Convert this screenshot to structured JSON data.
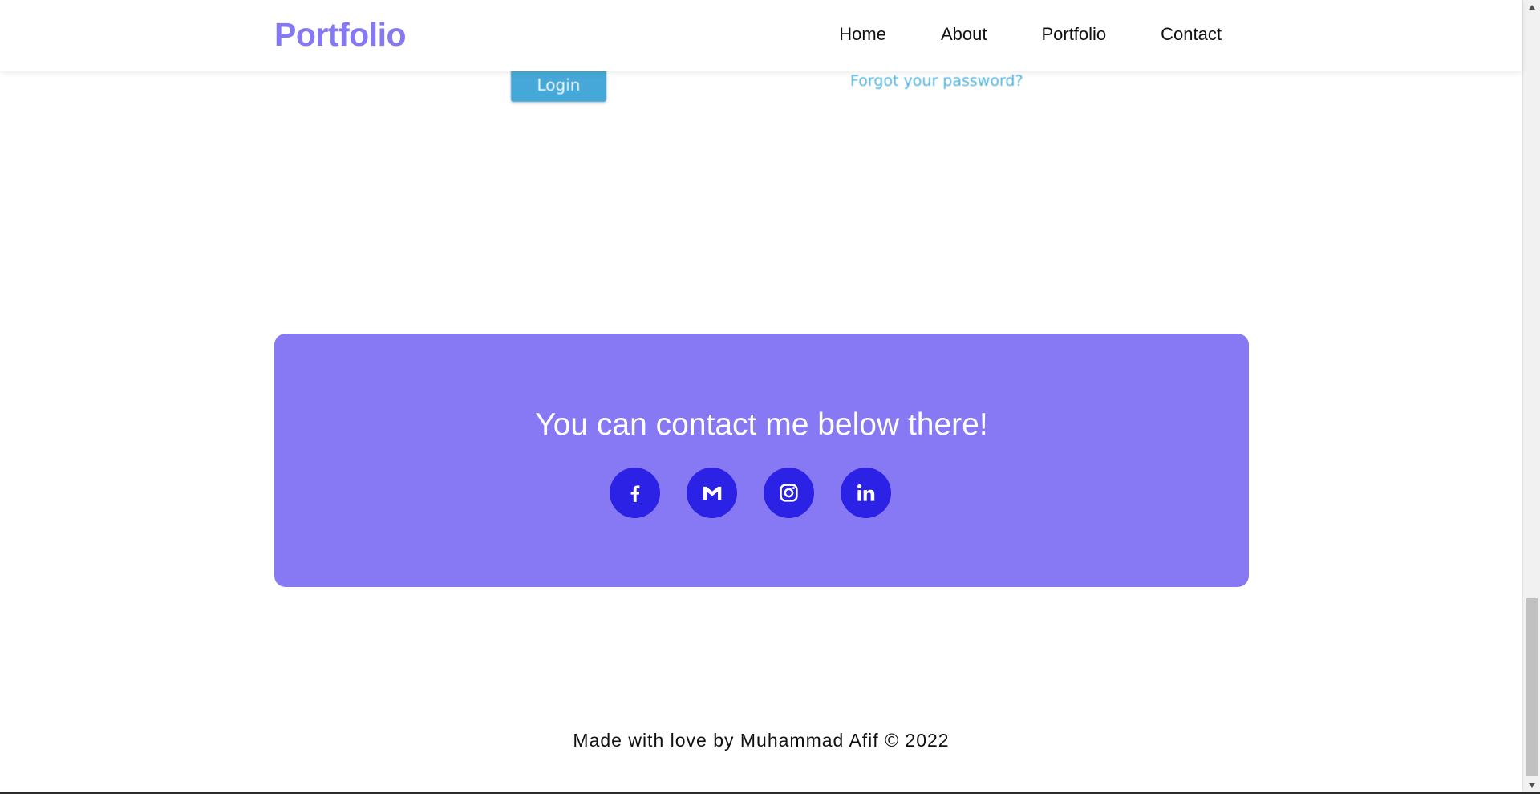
{
  "navbar": {
    "brand": "Portfolio",
    "links": [
      "Home",
      "About",
      "Portfolio",
      "Contact"
    ]
  },
  "screenshot_fragment": {
    "login_button": "Login",
    "forgot_link": "Forgot your password?"
  },
  "contact": {
    "title": "You can contact me below there!",
    "socials": [
      "facebook-icon",
      "gmail-icon",
      "instagram-icon",
      "linkedin-icon"
    ]
  },
  "footer": {
    "text": "Made with love by Muhammad Afif © 2022"
  },
  "colors": {
    "brand": "#8479f2",
    "card": "#8779f4",
    "social_bg": "#2b22e6"
  }
}
